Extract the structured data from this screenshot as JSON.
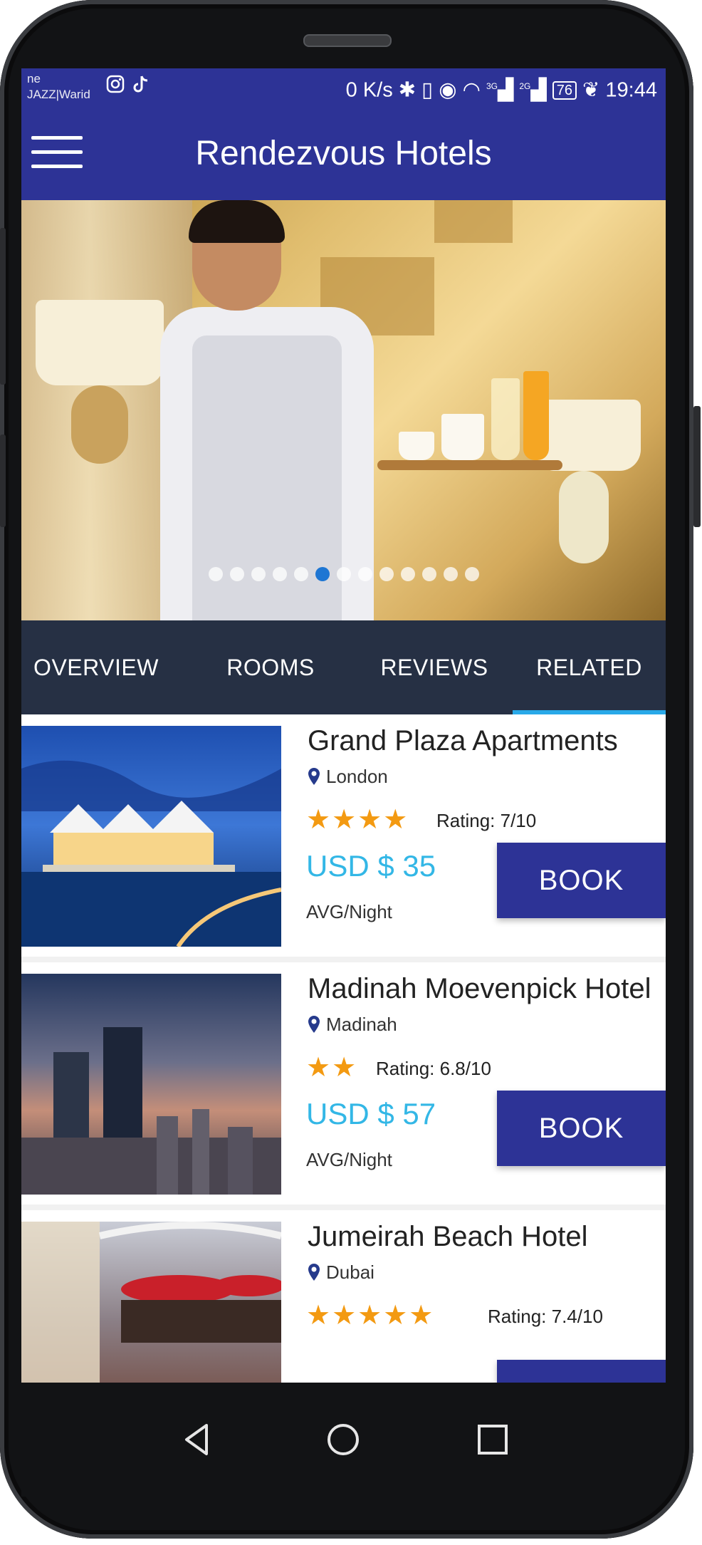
{
  "status_bar": {
    "carrier_line1": "ne",
    "carrier_line2": "JAZZ|Warid",
    "speed": "0 K/s",
    "network_3g": "3G",
    "network_2g": "2G",
    "battery": "76",
    "time": "19:44"
  },
  "app_bar": {
    "title": "Rendezvous Hotels"
  },
  "carousel": {
    "dot_count": 13,
    "active_index": 5
  },
  "tabs": [
    {
      "label": "OVERVIEW"
    },
    {
      "label": "ROOMS"
    },
    {
      "label": "REVIEWS"
    },
    {
      "label": "RELATED",
      "active": true
    }
  ],
  "hotels": [
    {
      "name": "Grand Plaza Apartments",
      "location": "London",
      "stars": 4,
      "rating_label": "Rating:",
      "rating_value": "7/10",
      "price": "USD $ 35",
      "price_unit": "AVG/Night",
      "book_label": "BOOK"
    },
    {
      "name": "Madinah Moevenpick Hotel",
      "location": "Madinah",
      "stars": 2,
      "rating_label": "Rating:",
      "rating_value": "6.8/10",
      "price": "USD $ 57",
      "price_unit": "AVG/Night",
      "book_label": "BOOK"
    },
    {
      "name": "Jumeirah Beach Hotel",
      "location": "Dubai",
      "stars": 5,
      "rating_label": "Rating:",
      "rating_value": "7.4/10",
      "price": "",
      "price_unit": "",
      "book_label": ""
    }
  ],
  "colors": {
    "primary": "#2d3396",
    "tab_bar": "#263044",
    "accent": "#29a9e8",
    "star": "#f39a12",
    "price": "#33b7e6"
  }
}
